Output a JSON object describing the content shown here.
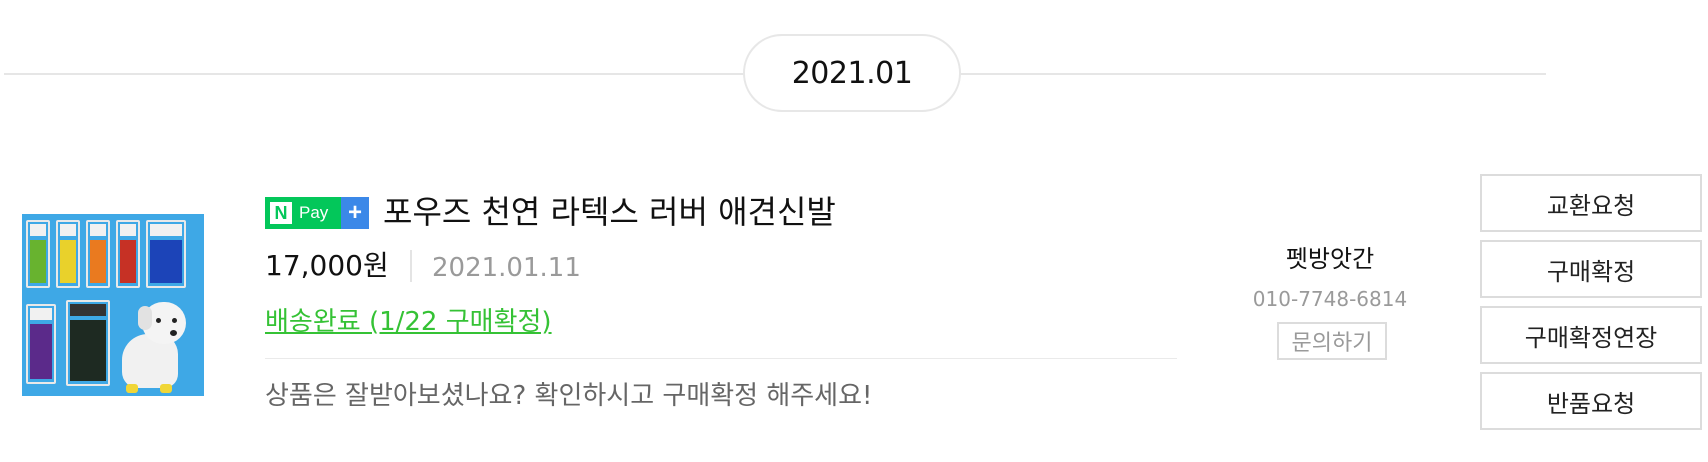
{
  "period": {
    "label": "2021.01"
  },
  "order": {
    "badge": {
      "n_letter": "N",
      "text": "Pay",
      "plus": "+"
    },
    "product_title": "포우즈 천연 라텍스 러버 애견신발",
    "price": "17,000원",
    "order_date": "2021.01.11",
    "status_link": "배송완료 (1/22 구매확정)",
    "message": "상품은 잘받아보셨나요? 확인하시고 구매확정 해주세요!"
  },
  "seller": {
    "name": "펫방앗간",
    "phone": "010-7748-6814",
    "inquiry_label": "문의하기"
  },
  "actions": {
    "exchange": "교환요청",
    "confirm": "구매확정",
    "extend": "구매확정연장",
    "return": "반품요청"
  },
  "colors": {
    "status_green": "#35c235",
    "npay_green": "#03c75a",
    "npay_plus_blue": "#3b88e8",
    "thumbnail_bg": "#3ea8e6"
  },
  "icons": {
    "thumbnail": "product-image",
    "badge": "npay-plus-badge"
  }
}
